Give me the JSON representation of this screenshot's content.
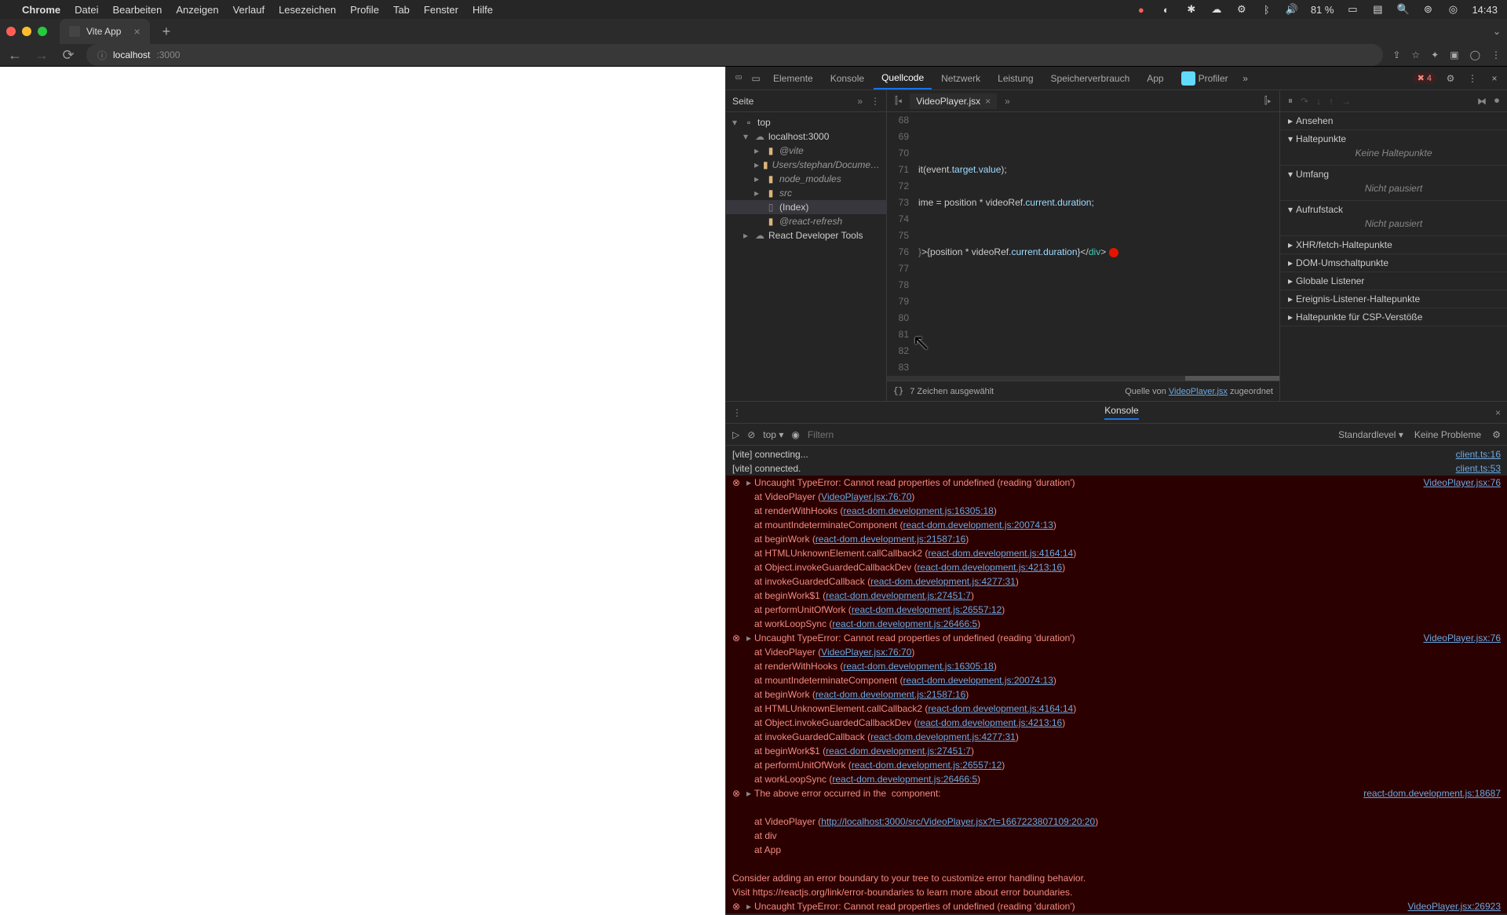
{
  "menubar": {
    "app": "Chrome",
    "items": [
      "Datei",
      "Bearbeiten",
      "Anzeigen",
      "Verlauf",
      "Lesezeichen",
      "Profile",
      "Tab",
      "Fenster",
      "Hilfe"
    ],
    "battery": "81 %",
    "time": "14:43"
  },
  "tab": {
    "title": "Vite App"
  },
  "address": {
    "host": "localhost",
    "port": ":3000"
  },
  "devtools": {
    "tabs": [
      "Elemente",
      "Konsole",
      "Quellcode",
      "Netzwerk",
      "Leistung",
      "Speicherverbrauch",
      "App"
    ],
    "active": "Quellcode",
    "profiler": "Profiler",
    "errcount": "4",
    "seite": "Seite",
    "files": {
      "top": "top",
      "host": "localhost:3000",
      "vite": "@vite",
      "users": "Users/stephan/Docume…",
      "node": "node_modules",
      "src": "src",
      "index": "(Index)",
      "refresh": "@react-refresh",
      "rdt": "React Developer Tools"
    },
    "editor": {
      "file": "VideoPlayer.jsx",
      "status_sel": "7 Zeichen ausgewählt",
      "status_src_pre": "Quelle von ",
      "status_src_link": "VideoPlayer.jsx",
      "status_src_post": " zugeordnet",
      "lines": [
        "68",
        "69",
        "70",
        "71",
        "72",
        "73",
        "74",
        "75",
        "76",
        "77",
        "78",
        "79",
        "80",
        "81",
        "82",
        "83"
      ],
      "code": {
        "l71": "it(event.target.value);",
        "l73": "ime = position * videoRef.current.duration;",
        "l76": "}>{position * videoRef.current.duration}</div>"
      }
    },
    "debugger": {
      "watch": "Ansehen",
      "break": "Haltepunkte",
      "nobreak": "Keine Haltepunkte",
      "scope": "Umfang",
      "notpaused": "Nicht pausiert",
      "callstack": "Aufrufstack",
      "xhr": "XHR/fetch-Haltepunkte",
      "dom": "DOM-Umschaltpunkte",
      "global": "Globale Listener",
      "event": "Ereignis-Listener-Haltepunkte",
      "csp": "Haltepunkte für CSP-Verstöße"
    }
  },
  "console": {
    "tab": "Konsole",
    "ctx": "top",
    "filter_ph": "Filtern",
    "level": "Standardlevel",
    "noprob": "Keine Probleme",
    "vite1": "[vite] connecting...",
    "vite1_src": "client.ts:16",
    "vite2": "[vite] connected.",
    "vite2_src": "client.ts:53",
    "err_title": "Uncaught TypeError: Cannot read properties of undefined (reading 'duration')",
    "err_src": "VideoPlayer.jsx:76",
    "stack": [
      {
        "fn": "VideoPlayer",
        "loc": "VideoPlayer.jsx:76:70"
      },
      {
        "fn": "renderWithHooks",
        "loc": "react-dom.development.js:16305:18"
      },
      {
        "fn": "mountIndeterminateComponent",
        "loc": "react-dom.development.js:20074:13"
      },
      {
        "fn": "beginWork",
        "loc": "react-dom.development.js:21587:16"
      },
      {
        "fn": "HTMLUnknownElement.callCallback2",
        "loc": "react-dom.development.js:4164:14"
      },
      {
        "fn": "Object.invokeGuardedCallbackDev",
        "loc": "react-dom.development.js:4213:16"
      },
      {
        "fn": "invokeGuardedCallback",
        "loc": "react-dom.development.js:4277:31"
      },
      {
        "fn": "beginWork$1",
        "loc": "react-dom.development.js:27451:7"
      },
      {
        "fn": "performUnitOfWork",
        "loc": "react-dom.development.js:26557:12"
      },
      {
        "fn": "workLoopSync",
        "loc": "react-dom.development.js:26466:5"
      }
    ],
    "above": "The above error occurred in the <VideoPlayer> component:",
    "above_src": "react-dom.development.js:18687",
    "compstack": [
      {
        "fn": "VideoPlayer",
        "loc": "http://localhost:3000/src/VideoPlayer.jsx?t=1667223807109:20:20"
      },
      {
        "fn": "div",
        "loc": ""
      },
      {
        "fn": "App",
        "loc": ""
      }
    ],
    "hint1": "Consider adding an error boundary to your tree to customize error handling behavior.",
    "hint2_pre": "Visit ",
    "hint2_link": "https://reactjs.org/link/error-boundaries",
    "hint2_post": " to learn more about error boundaries.",
    "err3_title": "Uncaught TypeError: Cannot read properties of undefined (reading 'duration')",
    "err3_src": "VideoPlayer.jsx:26923"
  }
}
